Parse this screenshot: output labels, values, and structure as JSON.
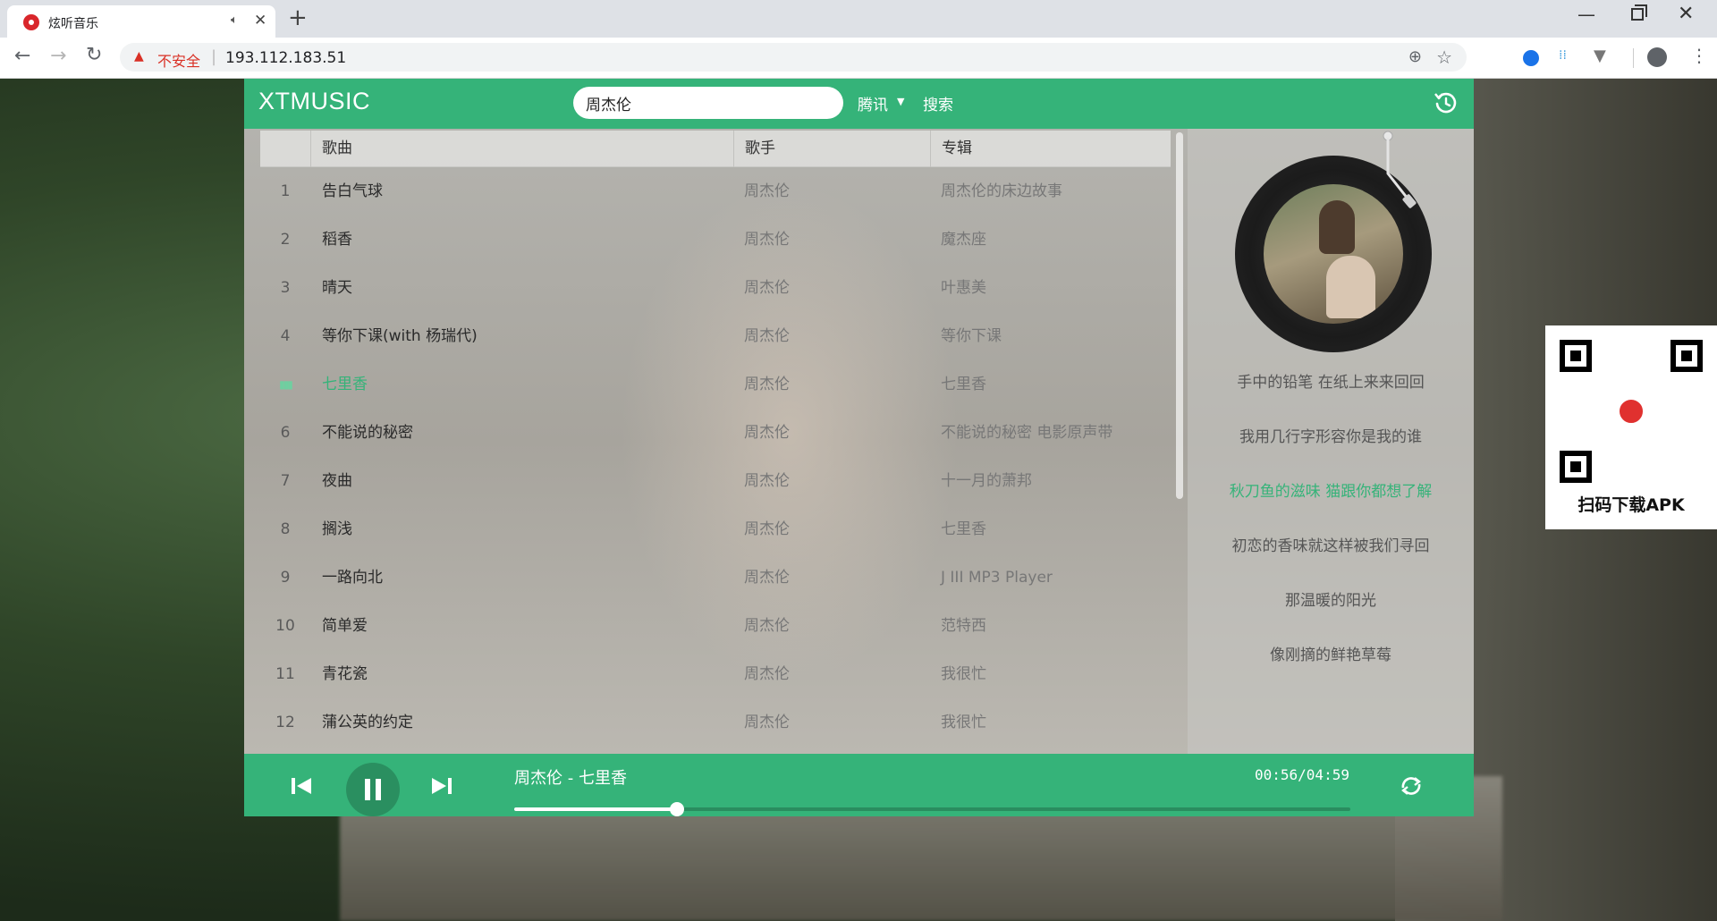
{
  "browser": {
    "tab_title": "炫听音乐",
    "tab_audio_icon": "speaker-icon",
    "tab_close": "✕",
    "new_tab": "+",
    "security_label": "不安全",
    "url": "193.112.183.51"
  },
  "header": {
    "logo": "XTMUSIC",
    "search_value": "周杰伦",
    "source": "腾讯",
    "search_button": "搜索",
    "history_icon": "history-icon"
  },
  "table": {
    "columns": [
      "歌曲",
      "歌手",
      "专辑"
    ],
    "rows": [
      {
        "idx": "1",
        "song": "告白气球",
        "artist": "周杰伦",
        "album": "周杰伦的床边故事"
      },
      {
        "idx": "2",
        "song": "稻香",
        "artist": "周杰伦",
        "album": "魔杰座"
      },
      {
        "idx": "3",
        "song": "晴天",
        "artist": "周杰伦",
        "album": "叶惠美"
      },
      {
        "idx": "4",
        "song": "等你下课(with 杨瑞代)",
        "artist": "周杰伦",
        "album": "等你下课"
      },
      {
        "idx": "▮▮▮",
        "song": "七里香",
        "artist": "周杰伦",
        "album": "七里香"
      },
      {
        "idx": "6",
        "song": "不能说的秘密",
        "artist": "周杰伦",
        "album": "不能说的秘密 电影原声带"
      },
      {
        "idx": "7",
        "song": "夜曲",
        "artist": "周杰伦",
        "album": "十一月的萧邦"
      },
      {
        "idx": "8",
        "song": "搁浅",
        "artist": "周杰伦",
        "album": "七里香"
      },
      {
        "idx": "9",
        "song": "一路向北",
        "artist": "周杰伦",
        "album": "J III MP3 Player"
      },
      {
        "idx": "10",
        "song": "简单爱",
        "artist": "周杰伦",
        "album": "范特西"
      },
      {
        "idx": "11",
        "song": "青花瓷",
        "artist": "周杰伦",
        "album": "我很忙"
      },
      {
        "idx": "12",
        "song": "蒲公英的约定",
        "artist": "周杰伦",
        "album": "我很忙"
      }
    ],
    "playing_row": 4
  },
  "lyrics": {
    "lines": [
      "手中的铅笔 在纸上来来回回",
      "我用几行字形容你是我的谁",
      "秋刀鱼的滋味 猫跟你都想了解",
      "初恋的香味就这样被我们寻回",
      "那温暖的阳光",
      "像刚摘的鲜艳草莓"
    ],
    "active_line": 2
  },
  "player": {
    "now_playing": "周杰伦 - 七里香",
    "time": "00:56/04:59",
    "progress": 0.195,
    "loop_icon": "loop-icon"
  },
  "qr": {
    "label": "扫码下载APK"
  },
  "colors": {
    "accent": "#35b379",
    "accent_dark": "#2a8f60",
    "warning": "#d93025"
  }
}
